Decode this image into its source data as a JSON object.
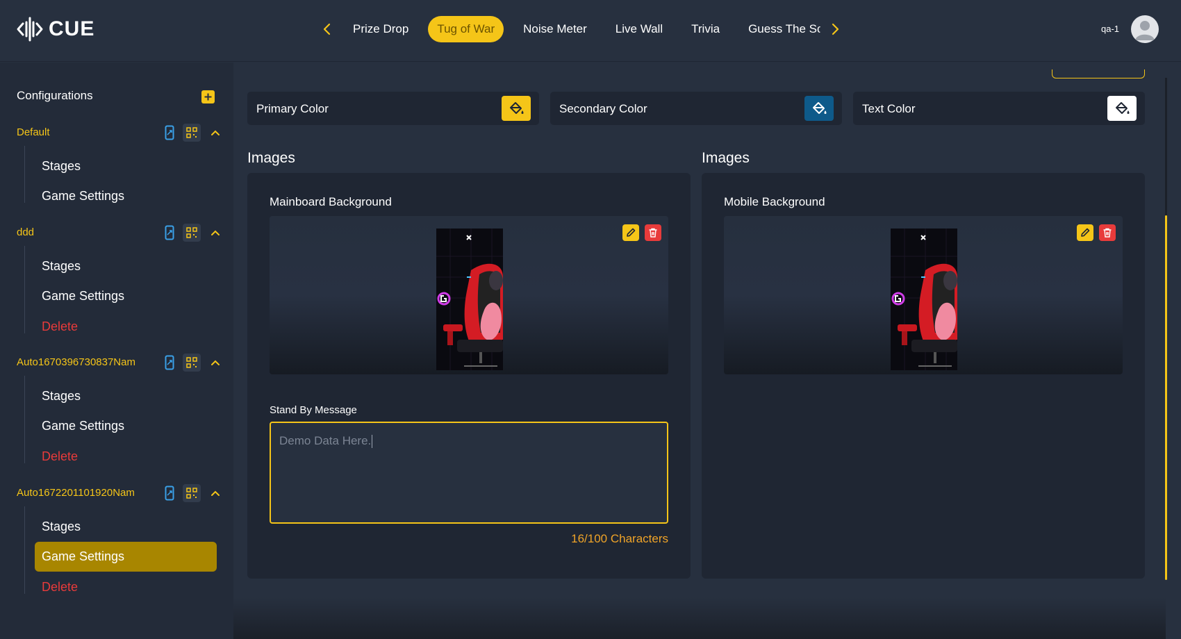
{
  "header": {
    "logo_text": "CUE",
    "tabs": [
      {
        "label": "Prize Drop"
      },
      {
        "label": "Tug of War",
        "active": true
      },
      {
        "label": "Noise Meter"
      },
      {
        "label": "Live Wall"
      },
      {
        "label": "Trivia"
      },
      {
        "label": "Guess The Sc"
      }
    ],
    "user_name": "qa-1",
    "accent_color": "#f5c518"
  },
  "sidebar": {
    "title": "Configurations",
    "configs": [
      {
        "name": "Default",
        "items": [
          "Stages",
          "Game Settings"
        ]
      },
      {
        "name": "ddd",
        "items": [
          "Stages",
          "Game Settings",
          "Delete"
        ]
      },
      {
        "name": "Auto1670396730837Nam",
        "items": [
          "Stages",
          "Game Settings",
          "Delete"
        ]
      },
      {
        "name": "Auto1672201101920Nam",
        "items": [
          "Stages",
          "Game Settings",
          "Delete"
        ],
        "active_item": "Game Settings"
      }
    ]
  },
  "colors": {
    "primary": {
      "label": "Primary Color",
      "swatch": "#f5c518"
    },
    "secondary": {
      "label": "Secondary Color",
      "swatch": "#0e5a8a"
    },
    "text": {
      "label": "Text Color",
      "swatch": "#ffffff"
    }
  },
  "left_panel": {
    "section_title": "Images",
    "image_label": "Mainboard Background",
    "message_label": "Stand By Message",
    "message_value": "Demo Data Here.",
    "char_count": "16/100 Characters"
  },
  "right_panel": {
    "section_title": "Images",
    "image_label": "Mobile Background"
  }
}
